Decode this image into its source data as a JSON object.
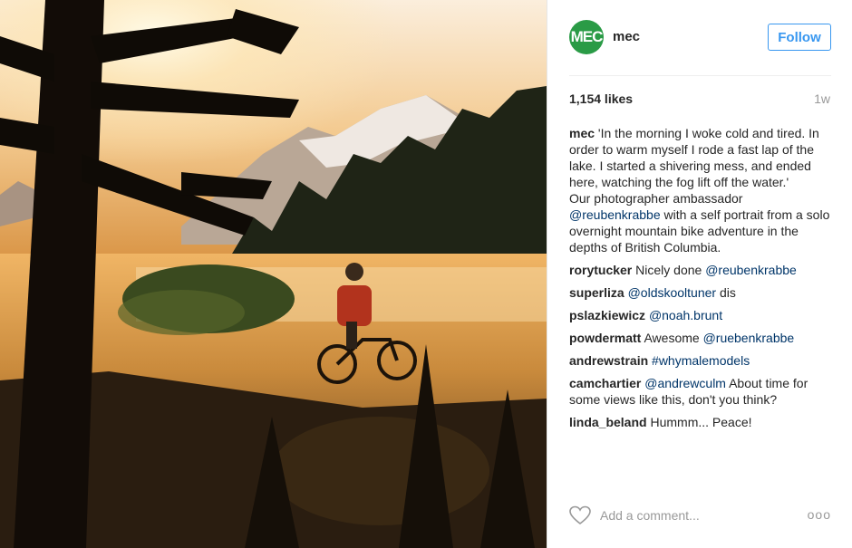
{
  "post": {
    "author": {
      "avatar_text": "MEC",
      "avatar_color": "#2a9b46",
      "username": "mec"
    },
    "follow_label": "Follow",
    "likes": "1,154 likes",
    "time_ago": "1w",
    "caption": {
      "user": "mec",
      "text": "'In the morning I woke cold and tired. In order to warm myself I rode a fast lap of the lake. I started a shivering mess, and ended here, watching the fog lift off the water.'\nOur photographer ambassador ",
      "mention": "@reubenkrabbe",
      "text_after": " with a self portrait from a solo overnight mountain bike adventure in the depths of British Columbia."
    },
    "comments": [
      {
        "user": "rorytucker",
        "pre": "Nicely done ",
        "mention": "@reubenkrabbe",
        "post": ""
      },
      {
        "user": "superliza",
        "pre": "",
        "mention": "@oldskooltuner",
        "post": " dis"
      },
      {
        "user": "pslazkiewicz",
        "pre": "",
        "mention": "@noah.brunt",
        "post": ""
      },
      {
        "user": "powdermatt",
        "pre": "Awesome ",
        "mention": "@ruebenkrabbe",
        "post": ""
      },
      {
        "user": "andrewstrain",
        "pre": "",
        "mention": "#whymalemodels",
        "post": ""
      },
      {
        "user": "camchartier",
        "pre": "",
        "mention": "@andrewculm",
        "post": " About time for some views like this, don't you think?"
      },
      {
        "user": "linda_beland",
        "pre": "Hummm... Peace!",
        "mention": "",
        "post": ""
      }
    ],
    "add_comment_placeholder": "Add a comment...",
    "more_label": "ooo",
    "colors": {
      "link": "#003569",
      "follow": "#3897f0",
      "muted": "#999999"
    }
  }
}
